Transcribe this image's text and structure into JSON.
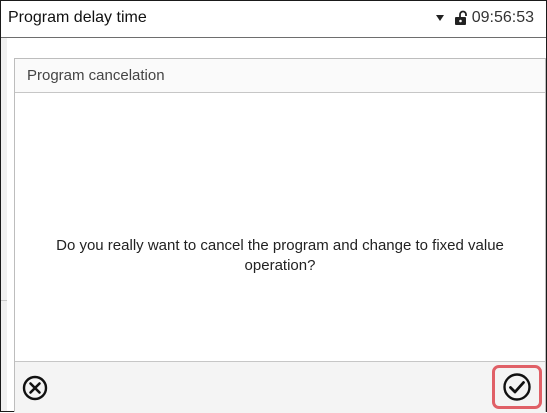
{
  "header": {
    "title": "Program delay time",
    "time": "09:56:53",
    "lock_icon": "lock-icon",
    "dropdown_icon": "caret-down-icon"
  },
  "dialog": {
    "title": "Program cancelation",
    "message": "Do you really want to cancel the program and change to fixed value operation?",
    "cancel_icon": "cancel-circle-icon",
    "confirm_icon": "check-circle-icon",
    "confirm_highlight_color": "#e06067"
  }
}
